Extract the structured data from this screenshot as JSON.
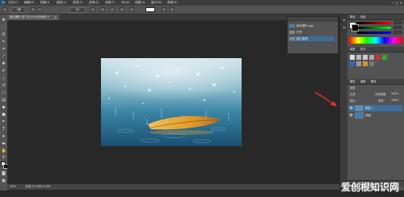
{
  "menubar": {
    "app_icon": "Ps",
    "items": [
      "文件(F)",
      "编辑(E)",
      "图像(I)",
      "图层(L)",
      "类型(Y)",
      "选择(S)",
      "滤镜(T)",
      "3D(D)",
      "视图(V)",
      "窗口(W)",
      "帮助(H)"
    ],
    "window_controls": "— ▢ ✕"
  },
  "options": {
    "width_value": "1像",
    "mode_label": "",
    "opacity_value": "",
    "field_value": "50"
  },
  "document": {
    "tab_title": "雨天落叶 @ 25.1% (RGB/8) *",
    "close": "×"
  },
  "status": {
    "zoom": "25%",
    "doc_info": "文档:13.3M/13.3M"
  },
  "history": {
    "items": [
      "雨天落叶.jpg",
      "打开",
      "建立图层"
    ]
  },
  "panels": {
    "color_tab": "颜色",
    "swatches_tab": "色板",
    "adjustments_tab": "调整",
    "styles_tab": "样式",
    "layers_tab": "图层",
    "channels_tab": "通道",
    "paths_tab": "路径",
    "layers_kind": "类型",
    "blend_mode": "正常",
    "opacity_label": "不透明度:",
    "opacity_value": "100%",
    "lock_label": "锁定:",
    "fill_label": "填充:",
    "fill_value": "100%",
    "layers": [
      {
        "name": "图层 1",
        "selected": true
      },
      {
        "name": "背景",
        "selected": false
      }
    ]
  },
  "watermark": "爱创根知识网",
  "colors": {
    "accent_blue": "#1f5a86",
    "annotation_arrow": "#e0322a",
    "selected_layer": "#3c6e9c"
  }
}
